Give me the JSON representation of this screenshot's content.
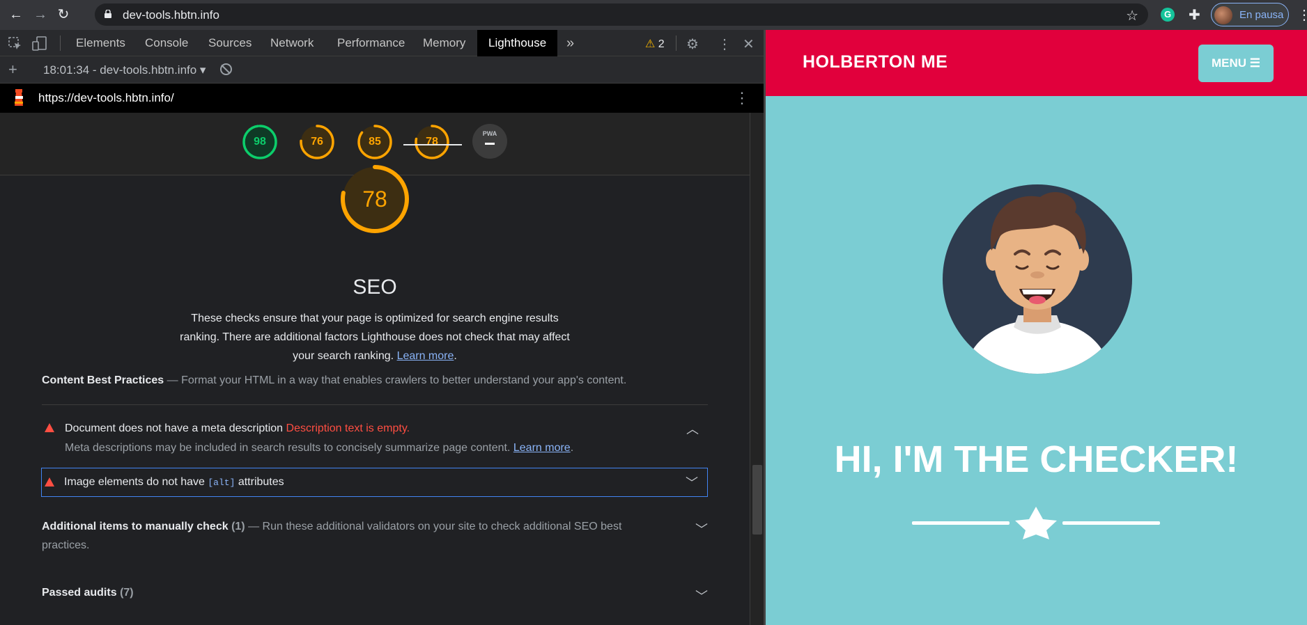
{
  "browser": {
    "url": "dev-tools.hbtn.info",
    "profile_label": "En pausa",
    "grammarly_letter": "G"
  },
  "devtools": {
    "tabs": [
      "Elements",
      "Console",
      "Sources",
      "Network",
      "Performance",
      "Memory",
      "Lighthouse"
    ],
    "active_tab": "Lighthouse",
    "more_tabs": "»",
    "warnings_count": "2",
    "report_label": "18:01:34 - dev-tools.hbtn.info",
    "lighthouse_url": "https://dev-tools.hbtn.info/"
  },
  "scores": [
    {
      "value": 98,
      "color": "#0cce6b",
      "bg": "#0f3a26"
    },
    {
      "value": 76,
      "color": "#ffa400",
      "bg": "#3d2e12"
    },
    {
      "value": 85,
      "color": "#ffa400",
      "bg": "#3d2e12"
    },
    {
      "value": 78,
      "color": "#ffa400",
      "bg": "#3d2e12"
    }
  ],
  "pwa_label": "PWA",
  "category": {
    "score": "78",
    "title": "SEO",
    "description": "These checks ensure that your page is optimized for search engine results ranking. There are additional factors Lighthouse does not check that may affect your search ranking.",
    "learn_more": "Learn more"
  },
  "group_cbp": {
    "title": "Content Best Practices",
    "description": "Format your HTML in a way that enables crawlers to better understand your app's content."
  },
  "audits": [
    {
      "title": "Document does not have a meta description",
      "display": "Description text is empty.",
      "detail": "Meta descriptions may be included in search results to concisely summarize page content.",
      "learn_more": "Learn more"
    },
    {
      "title_prefix": "Image elements do not have",
      "code": "[alt]",
      "title_suffix": "attributes"
    }
  ],
  "group_manual": {
    "title": "Additional items to manually check",
    "count": "(1)",
    "description": "Run these additional validators on your site to check additional SEO best practices."
  },
  "group_passed": {
    "title": "Passed audits",
    "count": "(7)"
  },
  "site": {
    "brand": "HOLBERTON ME",
    "menu_label": "MENU",
    "hero_title": "HI, I'M THE CHECKER!",
    "header_color": "#e1003c",
    "bg_color": "#7bcdd3"
  }
}
